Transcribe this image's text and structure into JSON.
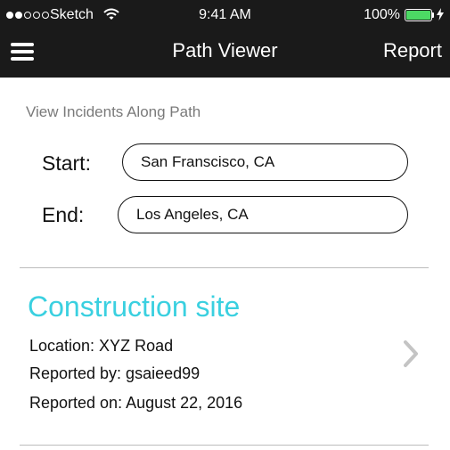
{
  "status_bar": {
    "carrier": "Sketch",
    "time": "9:41 AM",
    "battery": "100%",
    "signal_bars_filled": 2,
    "signal_bars_total": 5,
    "battery_level": 1.0,
    "battery_color": "#4cd964"
  },
  "nav": {
    "menu_icon": "hamburger-icon",
    "title": "Path Viewer",
    "report_label": "Report",
    "background": "#1a1a1a"
  },
  "path": {
    "section_label": "View Incidents Along Path",
    "start_label": "Start:",
    "start_value": "San Franscisco, CA",
    "end_label": "End:",
    "end_value": "Los Angeles, CA"
  },
  "incident": {
    "title": "Construction site",
    "title_color": "#3ad0e0",
    "location": "Location: XYZ Road",
    "reported_by": "Reported by: gsaieed99",
    "reported_on": "Reported on: August 22, 2016",
    "action_icon": "chevron-right-icon"
  }
}
